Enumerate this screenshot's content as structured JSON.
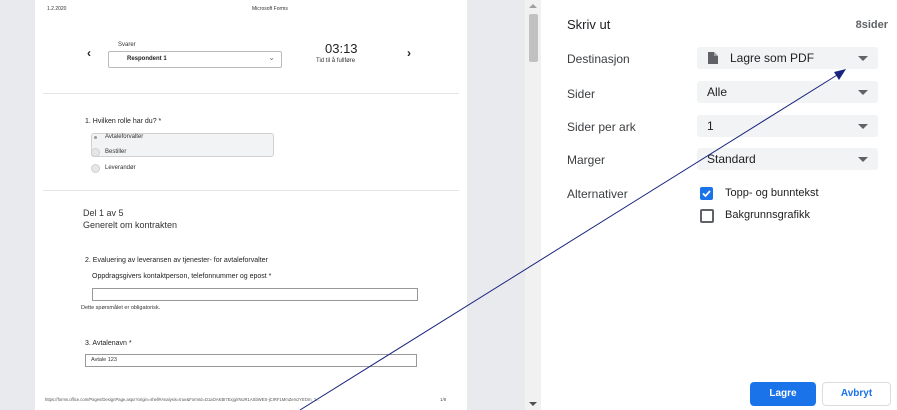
{
  "preview": {
    "page_header": {
      "date": "1.2.2020",
      "app": "Microsoft Forms"
    },
    "nav": {
      "prev_icon": "chevron-left-icon",
      "next_icon": "chevron-right-icon",
      "responder_label": "Svarer",
      "responder_value": "Respondent 1",
      "timer": "03:13",
      "timer_label": "Tid til å fullføre"
    },
    "q1": {
      "title": "1. Hvilken rolle har du? *",
      "options": [
        "Avtaleforvalter",
        "Bestiller",
        "Leverandør"
      ],
      "selected_index": 0
    },
    "section": {
      "part": "Del 1 av 5",
      "title": "Generelt om kontrakten"
    },
    "q2": {
      "title": "2. Evaluering av leveransen av tjenester- for avtaleforvalter",
      "subtitle": "Oppdragsgivers kontaktperson, telefonnummer og epost *",
      "required_note": "Dette spørsmålet er obligatorisk."
    },
    "q3": {
      "title": "3. Avtalenavn *",
      "answer": "Avtale 123"
    },
    "footer": {
      "url": "https://forms.office.com/Pages/DesignPage.aspx?origin=shell#Analysis=true&FormId=D1aOAKBI7Exjg/rNUR1ASbWES-jCIRF1MmZemzYEOm_1...",
      "page": "1/8"
    }
  },
  "print": {
    "title": "Skriv ut",
    "pages_count": "8sider",
    "destination": {
      "label": "Destinasjon",
      "value": "Lagre som PDF",
      "icon": "file-icon"
    },
    "pages": {
      "label": "Sider",
      "value": "Alle"
    },
    "pages_per_sheet": {
      "label": "Sider per ark",
      "value": "1"
    },
    "margins": {
      "label": "Marger",
      "value": "Standard"
    },
    "options": {
      "label": "Alternativer",
      "header_footer": {
        "label": "Topp- og bunntekst",
        "checked": true
      },
      "background": {
        "label": "Bakgrunnsgrafikk",
        "checked": false
      }
    },
    "buttons": {
      "save": "Lagre",
      "cancel": "Avbryt"
    }
  },
  "colors": {
    "accent": "#1a73e8",
    "arrow": "#1a237e",
    "preview_bg": "#e8eaed"
  }
}
